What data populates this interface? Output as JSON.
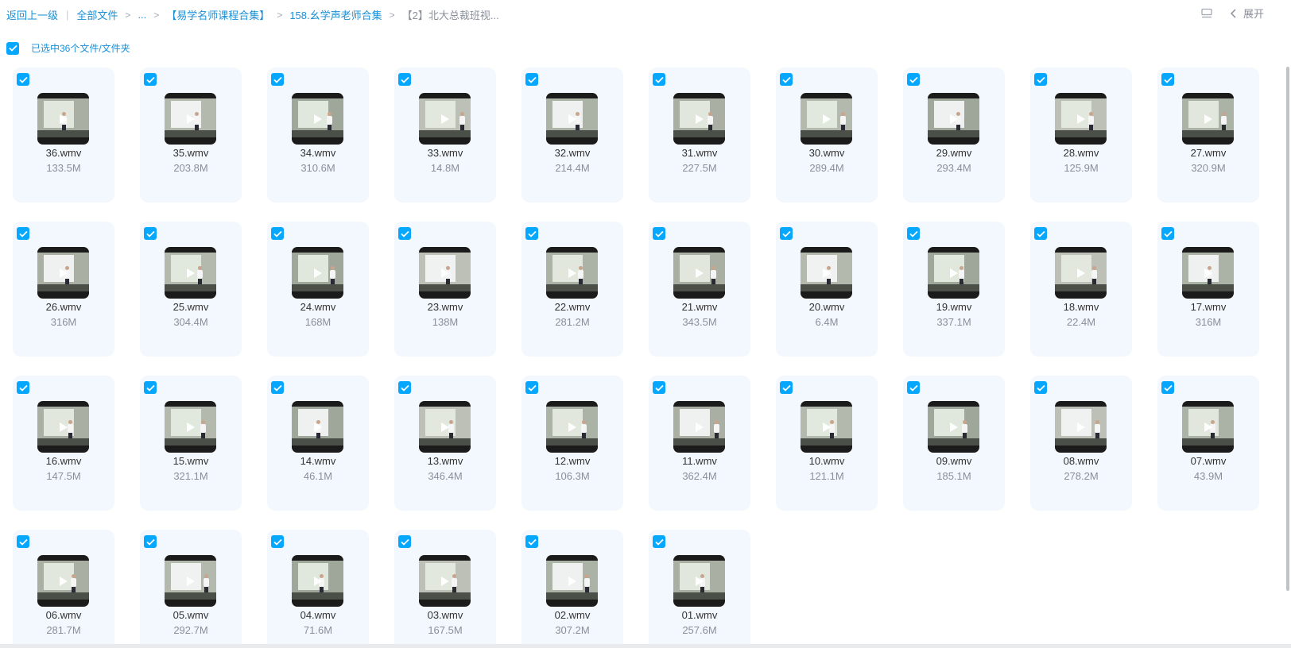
{
  "breadcrumb": {
    "back": "返回上一级",
    "all_files": "全部文件",
    "ellipsis": "...",
    "folder1": "【易学名师课程合集】",
    "folder2": "158.幺学声老师合集",
    "current": "【2】北大总裁班视..."
  },
  "toolbar": {
    "view_icon": "list-view-icon",
    "chevron_icon": "chevron-left-icon",
    "expand_label": "展开"
  },
  "selection": {
    "text": "已选中36个文件/文件夹",
    "checked": true
  },
  "colors": {
    "accent": "#06a7ff",
    "link": "#1a8fd6",
    "card_bg": "#f2f8fd",
    "muted": "#8a8f99"
  },
  "files": [
    {
      "name": "36.wmv",
      "size": "133.5M"
    },
    {
      "name": "35.wmv",
      "size": "203.8M"
    },
    {
      "name": "34.wmv",
      "size": "310.6M"
    },
    {
      "name": "33.wmv",
      "size": "14.8M"
    },
    {
      "name": "32.wmv",
      "size": "214.4M"
    },
    {
      "name": "31.wmv",
      "size": "227.5M"
    },
    {
      "name": "30.wmv",
      "size": "289.4M"
    },
    {
      "name": "29.wmv",
      "size": "293.4M"
    },
    {
      "name": "28.wmv",
      "size": "125.9M"
    },
    {
      "name": "27.wmv",
      "size": "320.9M"
    },
    {
      "name": "26.wmv",
      "size": "316M"
    },
    {
      "name": "25.wmv",
      "size": "304.4M"
    },
    {
      "name": "24.wmv",
      "size": "168M"
    },
    {
      "name": "23.wmv",
      "size": "138M"
    },
    {
      "name": "22.wmv",
      "size": "281.2M"
    },
    {
      "name": "21.wmv",
      "size": "343.5M"
    },
    {
      "name": "20.wmv",
      "size": "6.4M"
    },
    {
      "name": "19.wmv",
      "size": "337.1M"
    },
    {
      "name": "18.wmv",
      "size": "22.4M"
    },
    {
      "name": "17.wmv",
      "size": "316M"
    },
    {
      "name": "16.wmv",
      "size": "147.5M"
    },
    {
      "name": "15.wmv",
      "size": "321.1M"
    },
    {
      "name": "14.wmv",
      "size": "46.1M"
    },
    {
      "name": "13.wmv",
      "size": "346.4M"
    },
    {
      "name": "12.wmv",
      "size": "106.3M"
    },
    {
      "name": "11.wmv",
      "size": "362.4M"
    },
    {
      "name": "10.wmv",
      "size": "121.1M"
    },
    {
      "name": "09.wmv",
      "size": "185.1M"
    },
    {
      "name": "08.wmv",
      "size": "278.2M"
    },
    {
      "name": "07.wmv",
      "size": "43.9M"
    },
    {
      "name": "06.wmv",
      "size": "281.7M"
    },
    {
      "name": "05.wmv",
      "size": "292.7M"
    },
    {
      "name": "04.wmv",
      "size": "71.6M"
    },
    {
      "name": "03.wmv",
      "size": "167.5M"
    },
    {
      "name": "02.wmv",
      "size": "307.2M"
    },
    {
      "name": "01.wmv",
      "size": "257.6M"
    }
  ]
}
